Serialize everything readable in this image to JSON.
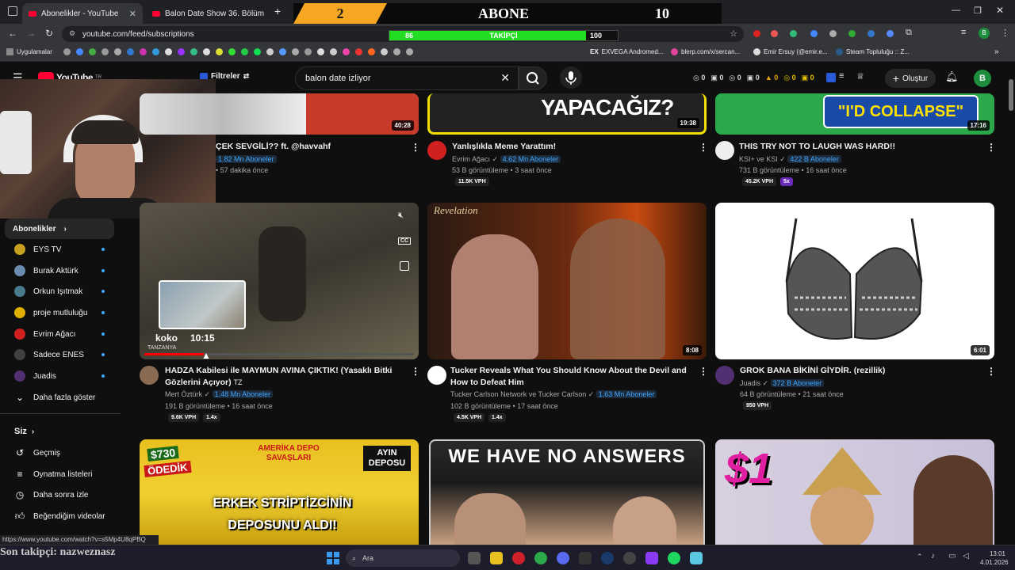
{
  "browser": {
    "tabs": [
      {
        "title": "Abonelikler - YouTube",
        "active": true
      },
      {
        "title": "Balon Date Show 36. Bölüm - Yo",
        "active": false
      }
    ],
    "url": "youtube.com/feed/subscriptions",
    "bookmarks": [
      "Uygulamalar",
      "EXVEGA Andromed...",
      "blerp.com/x/sercan...",
      "Emir Ersuy (@emir.e...",
      "Steam Topluluğu :: Z..."
    ]
  },
  "overlay": {
    "left_value": "2",
    "title": "ABONE",
    "right_value": "10",
    "bar_label": "TAKİPÇİ",
    "bar_current": "86",
    "bar_target": "100",
    "bar_fraction": 0.86
  },
  "youtube": {
    "logo": "YouTube",
    "logo_sup": "TR",
    "filters_label": "Filtreler",
    "search_value": "balon date izliyor",
    "header_stats": [
      "0",
      "0",
      "0",
      "0",
      "0",
      "0",
      "0"
    ],
    "create_label": "Oluştur",
    "avatar_letter": "B"
  },
  "sidebar": {
    "subs_heading": "Abonelikler",
    "channels": [
      {
        "name": "EYS TV",
        "color": "#c8a020"
      },
      {
        "name": "Burak Aktürk",
        "color": "#6a8cb0"
      },
      {
        "name": "Orkun Işıtmak",
        "color": "#4a7a90"
      },
      {
        "name": "proje mutluluğu",
        "color": "#e0b000"
      },
      {
        "name": "Evrim Ağacı",
        "color": "#d02020"
      },
      {
        "name": "Sadece ENES",
        "color": "#404040"
      },
      {
        "name": "Juadis",
        "color": "#503070"
      }
    ],
    "show_more": "Daha fazla göster",
    "you_heading": "Siz",
    "you_items": [
      "Geçmiş",
      "Oynatma listeleri",
      "Daha sonra izle",
      "Beğendiğim videolar"
    ]
  },
  "videos_row1": [
    {
      "title": "ÇEK SEVGİLİ?? ft. @havvahf",
      "subs": "1.82 Mn Aboneler",
      "meta": "57 dakika önce",
      "duration": "40:28"
    },
    {
      "title": "Yanlışlıkla Meme Yarattım!",
      "channel": "Evrim Ağacı",
      "subs": "4.62 Mn Aboneler",
      "meta": "53 B görüntüleme • 3 saat önce",
      "duration": "19:38",
      "thumb_text": "YAPACAĞIZ?",
      "tags": [
        "11.5K VPH"
      ]
    },
    {
      "title": "THIS TRY NOT TO LAUGH WAS HARD!!",
      "channel": "KSI+ ve KSI",
      "subs": "422 B Aboneler",
      "meta": "731 B görüntüleme • 16 saat önce",
      "duration": "17:16",
      "thumb_text": "\"I'D COLLAPSE\"",
      "tags": [
        "45.2K VPH",
        "5x"
      ]
    }
  ],
  "videos_row2": [
    {
      "title": "HADZA Kabilesi ile MAYMUN AVINA ÇIKTIK! (Yasaklı Bitki Gözlerini Açıyor)",
      "title_suffix": "TZ",
      "channel": "Mert Öztürk",
      "subs": "1.48 Mn Aboneler",
      "meta": "191 B görüntüleme • 16 saat önce",
      "tags": [
        "9.6K VPH",
        "1.4x"
      ],
      "preview_chapter": "koko",
      "preview_time": "10:15",
      "preview_caption": "TANZANYA",
      "progress_fraction": 0.22
    },
    {
      "title": "Tucker Reveals What You Should Know About the Devil and How to Defeat Him",
      "channel": "Tucker Carlson Network ve Tucker Carlson",
      "subs": "1.63 Mn Aboneler",
      "meta": "102 B görüntüleme • 17 saat önce",
      "tags": [
        "4.5K VPH",
        "1.4x"
      ],
      "duration": "8:08",
      "thumb_text": "Revelation"
    },
    {
      "title": "GROK BANA BİKİNİ GİYDİR. (rezillik)",
      "channel": "Juadis",
      "subs": "372 B Aboneler",
      "meta": "64 B görüntüleme • 21 saat önce",
      "tags": [
        "950 VPH"
      ],
      "duration": "6:01"
    }
  ],
  "videos_row3": [
    {
      "thumb_lines": [
        "$730",
        "ÖDEDİK",
        "AMERİKA DEPO SAVAŞLARI",
        "AYIN DEPOSU",
        "ERKEK STRİPTİZCİNİN",
        "DEPOSUNU ALDI!"
      ]
    },
    {
      "thumb_lines": [
        "WE HAVE NO ANSWERS"
      ]
    },
    {
      "thumb_lines": [
        "$1"
      ]
    }
  ],
  "status_url": "https://www.youtube.com/watch?v=s5Mp4U8qPBQ",
  "stream": {
    "last_follower": "Son takipçi: nazweznasz"
  },
  "taskbar": {
    "search_label": "Ara",
    "time": "13:01",
    "date": "4.01.2026"
  }
}
